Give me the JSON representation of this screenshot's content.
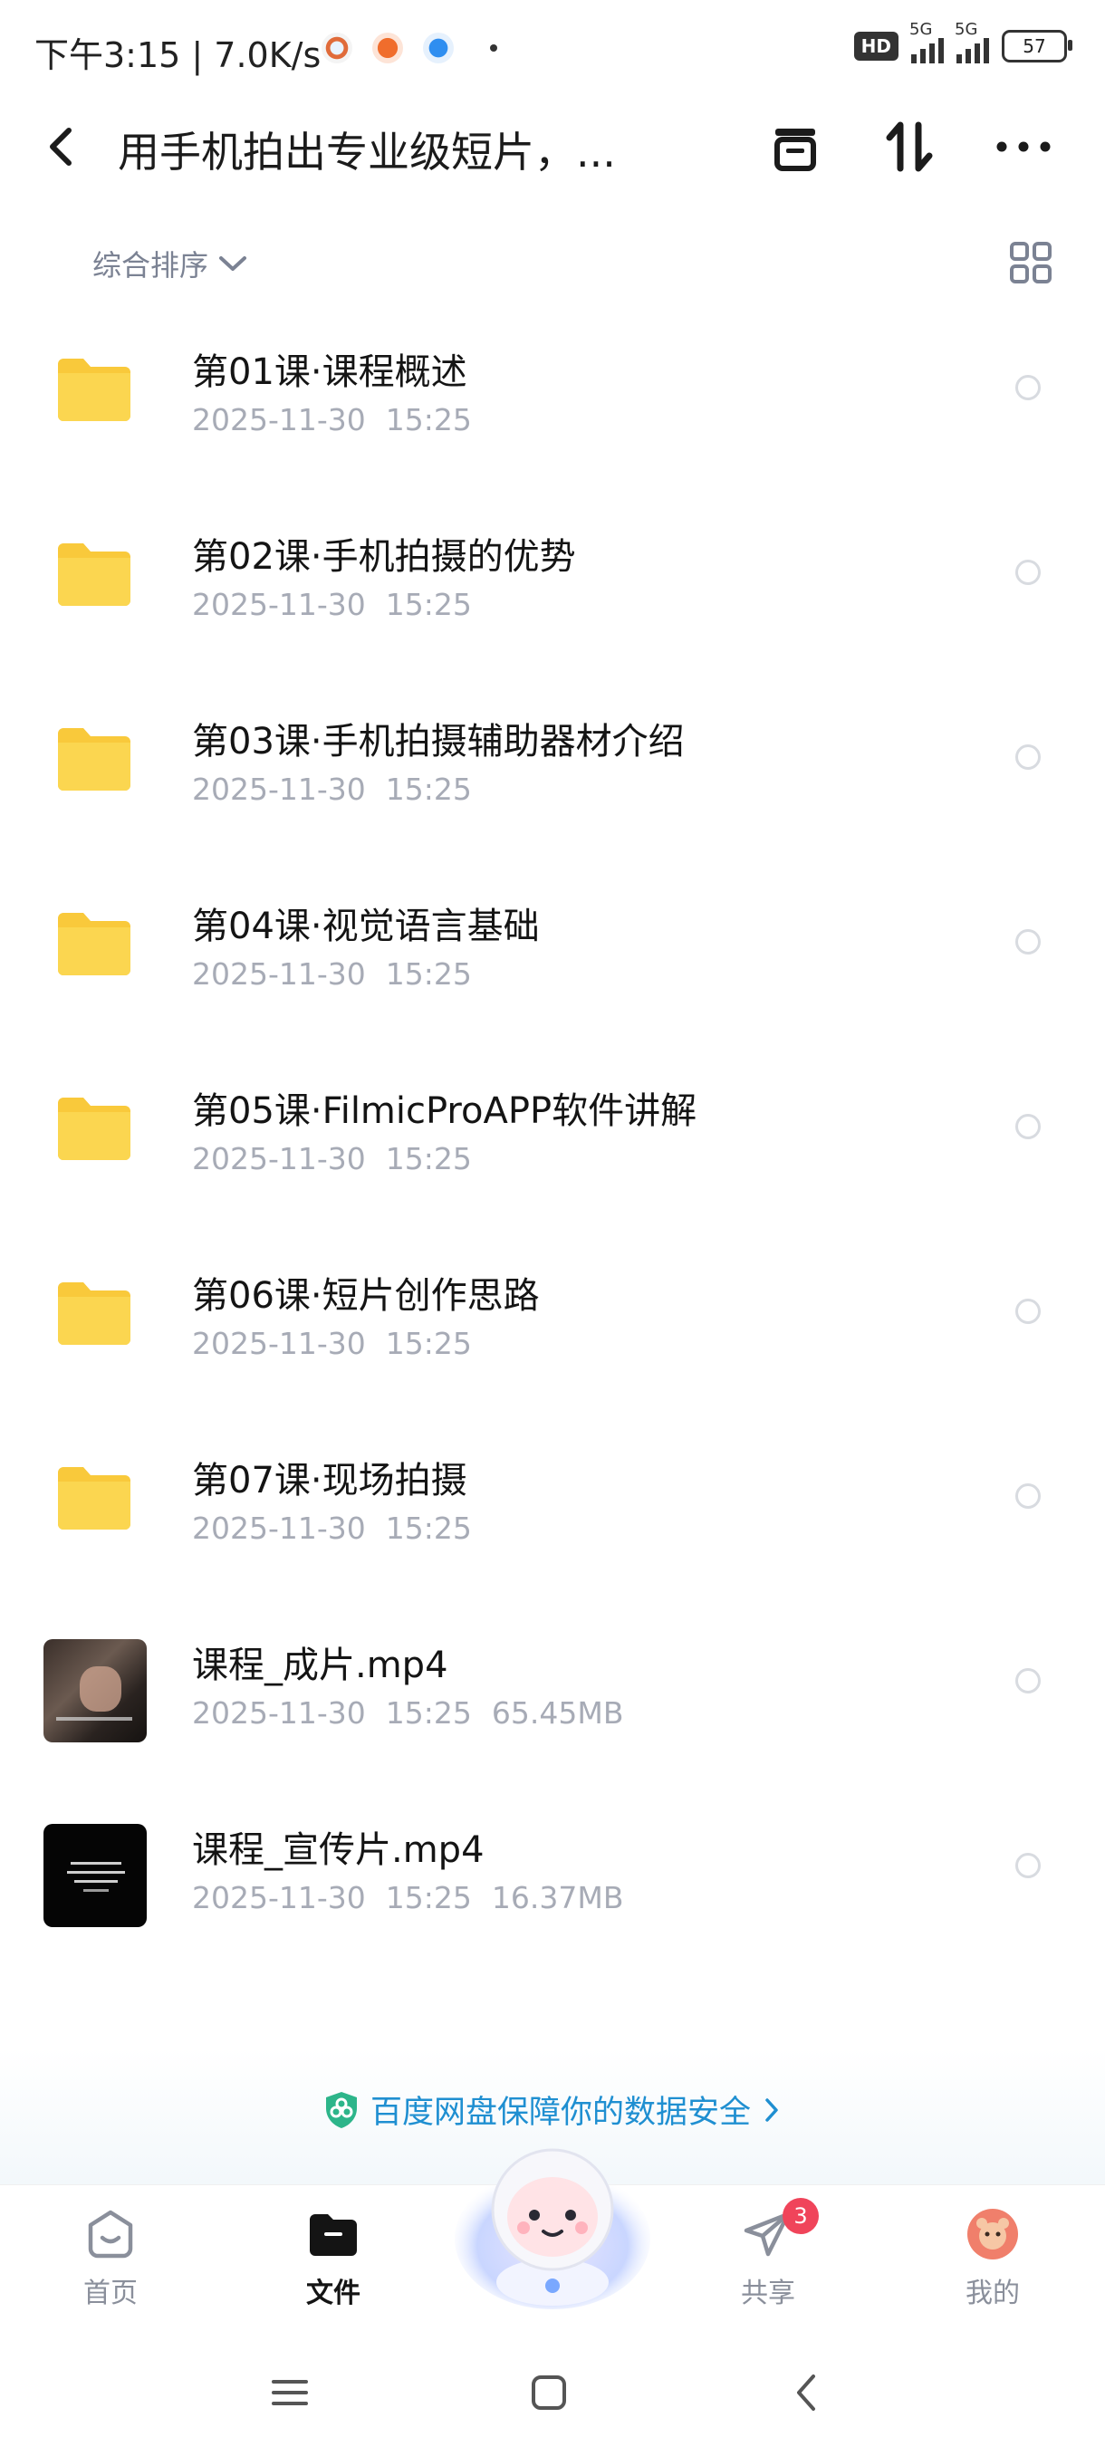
{
  "status_bar": {
    "time": "下午3:15 | 7.0K/s",
    "hd": "HD",
    "network1": "5G",
    "network2": "5G",
    "battery": "57"
  },
  "header": {
    "title": "用手机拍出专业级短片，..."
  },
  "sort": {
    "label": "综合排序"
  },
  "files": [
    {
      "name": "第01课·课程概述",
      "date": "2025-11-30",
      "time": "15:25",
      "size": "",
      "type": "folder"
    },
    {
      "name": "第02课·手机拍摄的优势",
      "date": "2025-11-30",
      "time": "15:25",
      "size": "",
      "type": "folder"
    },
    {
      "name": "第03课·手机拍摄辅助器材介绍",
      "date": "2025-11-30",
      "time": "15:25",
      "size": "",
      "type": "folder"
    },
    {
      "name": "第04课·视觉语言基础",
      "date": "2025-11-30",
      "time": "15:25",
      "size": "",
      "type": "folder"
    },
    {
      "name": "第05课·FilmicProAPP软件讲解",
      "date": "2025-11-30",
      "time": "15:25",
      "size": "",
      "type": "folder"
    },
    {
      "name": "第06课·短片创作思路",
      "date": "2025-11-30",
      "time": "15:25",
      "size": "",
      "type": "folder"
    },
    {
      "name": "第07课·现场拍摄",
      "date": "2025-11-30",
      "time": "15:25",
      "size": "",
      "type": "folder"
    },
    {
      "name": "课程_成片.mp4",
      "date": "2025-11-30",
      "time": "15:25",
      "size": "65.45MB",
      "type": "video"
    },
    {
      "name": "课程_宣传片.mp4",
      "date": "2025-11-30",
      "time": "15:25",
      "size": "16.37MB",
      "type": "video"
    }
  ],
  "banner": {
    "text": "百度网盘保障你的数据安全"
  },
  "tabs": {
    "home": "首页",
    "files": "文件",
    "share": "共享",
    "share_badge": "3",
    "mine": "我的"
  },
  "colors": {
    "accent": "#1f8fd1",
    "folder": "#f9c93b",
    "badge": "#f0445a"
  }
}
